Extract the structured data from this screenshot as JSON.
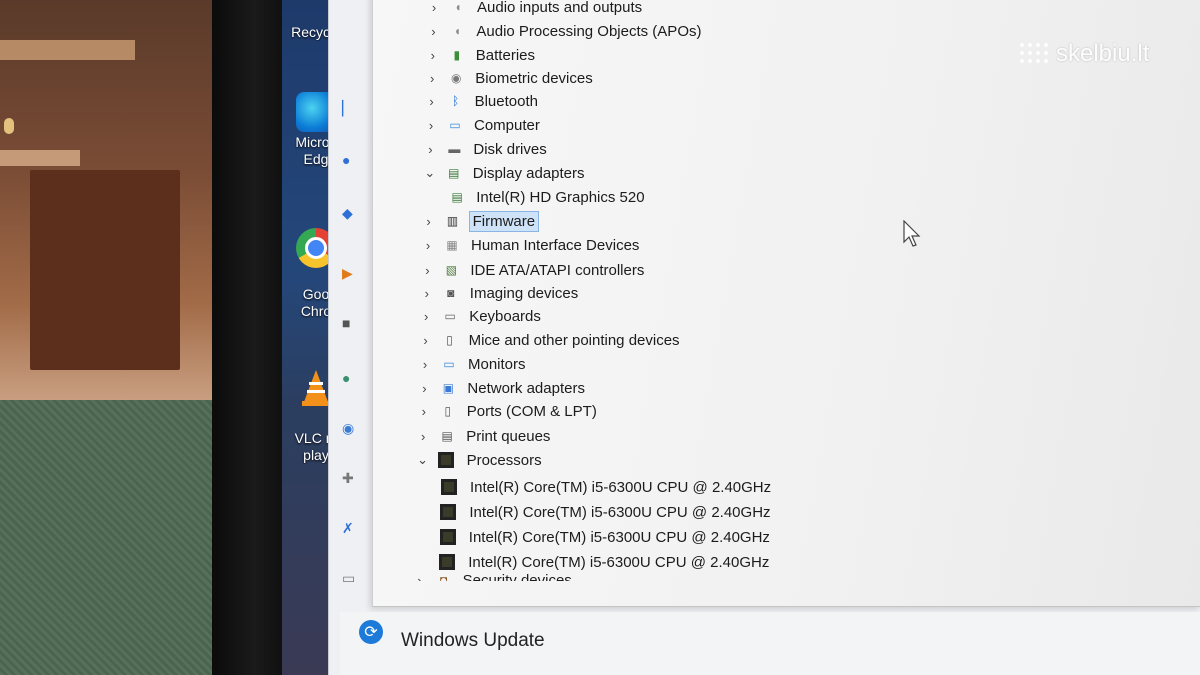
{
  "watermark": {
    "text": "skelbiu.lt"
  },
  "desktop": {
    "icons": [
      {
        "label": "Recycle",
        "icon": "recycle-bin-icon"
      },
      {
        "label": "Micros",
        "label2": "Edg",
        "icon": "edge-icon"
      },
      {
        "label": "Goo",
        "label2": "Chro",
        "icon": "chrome-icon"
      },
      {
        "label": "VLC m",
        "label2": "play",
        "icon": "vlc-icon"
      }
    ]
  },
  "device_tree": [
    {
      "label": "Audio inputs and outputs",
      "expanded": false,
      "icon": "speaker-icon"
    },
    {
      "label": "Audio Processing Objects (APOs)",
      "expanded": false,
      "icon": "speaker-icon"
    },
    {
      "label": "Batteries",
      "expanded": false,
      "icon": "battery-icon"
    },
    {
      "label": "Biometric devices",
      "expanded": false,
      "icon": "biometric-icon"
    },
    {
      "label": "Bluetooth",
      "expanded": false,
      "icon": "bluetooth-icon"
    },
    {
      "label": "Computer",
      "expanded": false,
      "icon": "computer-icon"
    },
    {
      "label": "Disk drives",
      "expanded": false,
      "icon": "disk-drive-icon"
    },
    {
      "label": "Display adapters",
      "expanded": true,
      "icon": "display-adapter-icon",
      "children": [
        {
          "label": "Intel(R) HD Graphics 520",
          "icon": "display-adapter-icon"
        }
      ]
    },
    {
      "label": "Firmware",
      "expanded": false,
      "selected": true,
      "icon": "firmware-icon"
    },
    {
      "label": "Human Interface Devices",
      "expanded": false,
      "icon": "hid-icon"
    },
    {
      "label": "IDE ATA/ATAPI controllers",
      "expanded": false,
      "icon": "ide-controller-icon"
    },
    {
      "label": "Imaging devices",
      "expanded": false,
      "icon": "camera-icon"
    },
    {
      "label": "Keyboards",
      "expanded": false,
      "icon": "keyboard-icon"
    },
    {
      "label": "Mice and other pointing devices",
      "expanded": false,
      "icon": "mouse-icon"
    },
    {
      "label": "Monitors",
      "expanded": false,
      "icon": "monitor-icon"
    },
    {
      "label": "Network adapters",
      "expanded": false,
      "icon": "network-adapter-icon"
    },
    {
      "label": "Ports (COM & LPT)",
      "expanded": false,
      "icon": "port-icon"
    },
    {
      "label": "Print queues",
      "expanded": false,
      "icon": "printer-icon"
    },
    {
      "label": "Processors",
      "expanded": true,
      "icon": "processor-icon",
      "children": [
        {
          "label": "Intel(R) Core(TM) i5-6300U CPU @ 2.40GHz",
          "icon": "processor-icon"
        },
        {
          "label": "Intel(R) Core(TM) i5-6300U CPU @ 2.40GHz",
          "icon": "processor-icon"
        },
        {
          "label": "Intel(R) Core(TM) i5-6300U CPU @ 2.40GHz",
          "icon": "processor-icon"
        },
        {
          "label": "Intel(R) Core(TM) i5-6300U CPU @ 2.40GHz",
          "icon": "processor-icon"
        }
      ]
    },
    {
      "label": "Security devices",
      "expanded": false,
      "icon": "security-icon"
    }
  ],
  "settings": {
    "windows_update_label": "Windows Update"
  },
  "colors": {
    "selection_bg": "#cfe3f8",
    "selection_border": "#8ab4e4",
    "accent": "#1e7ad9"
  }
}
